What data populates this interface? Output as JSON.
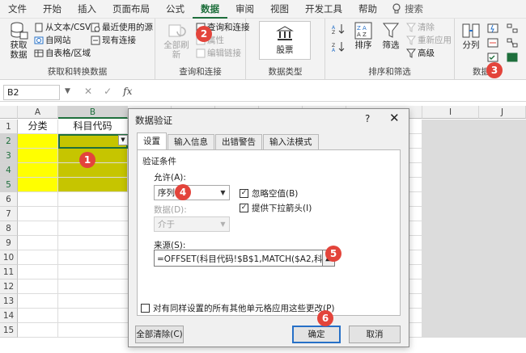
{
  "menu": {
    "tabs": [
      "文件",
      "开始",
      "插入",
      "页面布局",
      "公式",
      "数据",
      "审阅",
      "视图",
      "开发工具",
      "帮助"
    ],
    "active_tab": "数据",
    "search_label": "搜索"
  },
  "ribbon": {
    "get_data": {
      "big_button": "获取数据",
      "items": [
        "从文本/CSV",
        "自网站",
        "自表格/区域",
        "最近使用的源",
        "现有连接"
      ],
      "label": "获取和转换数据"
    },
    "queries": {
      "refresh_all": "全部刷新",
      "items": [
        "查询和连接",
        "属性",
        "编辑链接"
      ],
      "label": "查询和连接"
    },
    "data_types": {
      "stock": "股票",
      "label": "数据类型"
    },
    "sort_filter": {
      "sort": "排序",
      "filter": "筛选",
      "items": [
        "清除",
        "重新应用",
        "高级"
      ],
      "label": "排序和筛选"
    },
    "tools": {
      "split": "分列",
      "label": "数据"
    }
  },
  "formula_bar": {
    "name_box": "B2",
    "fx": "fx"
  },
  "sheet": {
    "columns": [
      "A",
      "B",
      "C",
      "D",
      "E",
      "F",
      "G",
      "H",
      "I",
      "J"
    ],
    "selected_column": "B",
    "rows": [
      "1",
      "2",
      "3",
      "4",
      "5",
      "6",
      "7",
      "8",
      "9",
      "10",
      "11",
      "12",
      "13",
      "14",
      "15"
    ],
    "cells": {
      "A1": "分类",
      "B1": "科目代码"
    }
  },
  "dialog": {
    "title": "数据验证",
    "help": "?",
    "close": "✕",
    "tabs": [
      "设置",
      "输入信息",
      "出错警告",
      "输入法模式"
    ],
    "active_tab": "设置",
    "section_title": "验证条件",
    "allow_label": "允许(A):",
    "allow_value": "序列",
    "data_label": "数据(D):",
    "data_value": "介于",
    "ignore_blank": "忽略空值(B)",
    "ignore_blank_checked": true,
    "dropdown_arrow": "提供下拉箭头(I)",
    "dropdown_arrow_checked": true,
    "source_label": "来源(S):",
    "source_value": "=OFFSET(科目代码!$B$1,MATCH($A2,科目代码",
    "apply_all": "对有同样设置的所有其他单元格应用这些更改(P)",
    "apply_all_checked": false,
    "clear_all": "全部清除(C)",
    "ok": "确定",
    "cancel": "取消"
  },
  "markers": [
    "1",
    "2",
    "3",
    "4",
    "5",
    "6"
  ],
  "colors": {
    "accent": "#1e6f3c",
    "marker": "#e3443b",
    "yellow": "#ffff00",
    "olive": "#c6c500",
    "focus": "#2670c7"
  }
}
